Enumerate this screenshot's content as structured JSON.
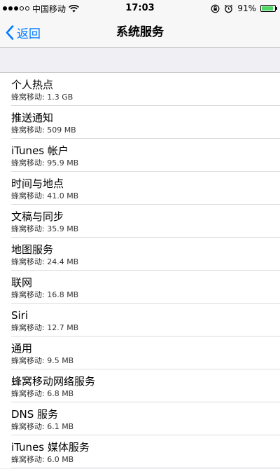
{
  "status_bar": {
    "carrier": "中国移动",
    "time": "17:03",
    "battery": "91%",
    "battery_level": 0.91
  },
  "nav": {
    "back_label": "返回",
    "title": "系统服务"
  },
  "items": [
    {
      "name": "个人热点",
      "usage": "蜂窝移动: 1.3 GB"
    },
    {
      "name": "推送通知",
      "usage": "蜂窝移动: 509 MB"
    },
    {
      "name": "iTunes 帐户",
      "usage": "蜂窝移动: 95.9 MB"
    },
    {
      "name": "时间与地点",
      "usage": "蜂窝移动: 41.0 MB"
    },
    {
      "name": "文稿与同步",
      "usage": "蜂窝移动: 35.9 MB"
    },
    {
      "name": "地图服务",
      "usage": "蜂窝移动: 24.4 MB"
    },
    {
      "name": "联网",
      "usage": "蜂窝移动: 16.8 MB"
    },
    {
      "name": "Siri",
      "usage": "蜂窝移动: 12.7 MB"
    },
    {
      "name": "通用",
      "usage": "蜂窝移动: 9.5 MB"
    },
    {
      "name": "蜂窝移动网络服务",
      "usage": "蜂窝移动: 6.8 MB"
    },
    {
      "name": "DNS 服务",
      "usage": "蜂窝移动: 6.1 MB"
    },
    {
      "name": "iTunes 媒体服务",
      "usage": "蜂窝移动: 6.0 MB"
    }
  ]
}
